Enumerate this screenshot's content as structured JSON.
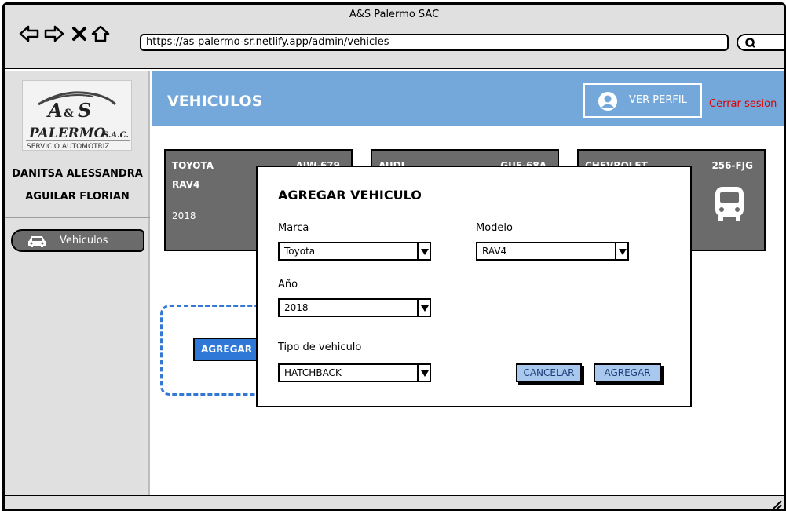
{
  "browser": {
    "title": "A&S Palermo SAC",
    "url": "https://as-palermo-sr.netlify.app/admin/vehicles"
  },
  "sidebar": {
    "logo_text": "A&S PALERMO S.A.C. SERVICIO AUTOMOTRIZ",
    "user_line1": "DANITSA ALESSANDRA",
    "user_line2": "AGUILAR FLORIAN",
    "items": [
      {
        "label": "Vehiculos",
        "icon": "car-icon"
      }
    ]
  },
  "header": {
    "title": "VEHICULOS",
    "profile_label": "VER PERFIL",
    "logout_label": "Cerrar sesion"
  },
  "cards": [
    {
      "brand": "TOYOTA",
      "model": "RAV4",
      "year": "2018",
      "plate": "AIW-679"
    },
    {
      "brand": "AUDI",
      "model": "",
      "year": "",
      "plate": "GUE-68A"
    },
    {
      "brand": "CHEVROLET",
      "model": "",
      "year": "",
      "plate": "256-FJG",
      "icon": "bus-icon"
    }
  ],
  "add_button_label": "AGREGAR",
  "modal": {
    "title": "AGREGAR VEHICULO",
    "marca_label": "Marca",
    "marca_value": "Toyota",
    "modelo_label": "Modelo",
    "modelo_value": "RAV4",
    "anio_label": "Año",
    "anio_value": "2018",
    "tipo_label": "Tipo de vehiculo",
    "tipo_value": "HATCHBACK",
    "cancel_label": "CANCELAR",
    "submit_label": "AGREGAR"
  },
  "colors": {
    "header_blue": "#74a8da",
    "card_gray": "#6b6b6b",
    "accent_blue": "#2f78d8",
    "logout_red": "#e00000"
  }
}
